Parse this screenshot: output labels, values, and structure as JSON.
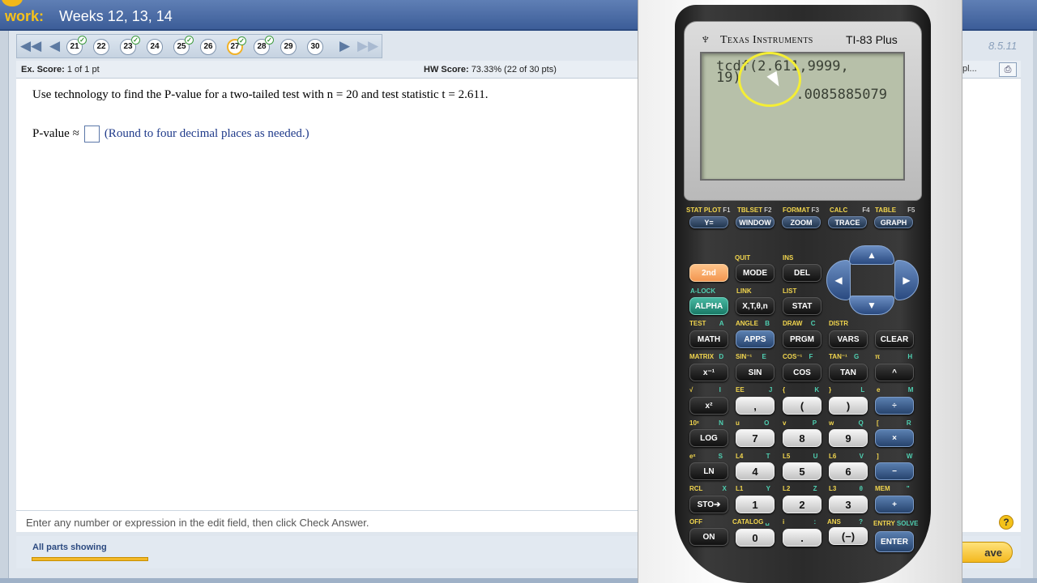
{
  "header": {
    "title_prefix": "work:",
    "title": "Weeks 12, 13, 14"
  },
  "nav": {
    "first": "◀◀",
    "prev": "◀",
    "next": "▶",
    "last": "▶▶",
    "questions": [
      {
        "num": "21",
        "done": "✓"
      },
      {
        "num": "22",
        "done": ""
      },
      {
        "num": "23",
        "done": "✓"
      },
      {
        "num": "24",
        "done": ""
      },
      {
        "num": "25",
        "done": "✓"
      },
      {
        "num": "26",
        "done": ""
      },
      {
        "num": "27",
        "done": "✓"
      },
      {
        "num": "28",
        "done": "✓"
      },
      {
        "num": "29",
        "done": ""
      },
      {
        "num": "30",
        "done": ""
      }
    ],
    "current": "27"
  },
  "version": "8.5.11",
  "score": {
    "ex_label": "Ex. Score:",
    "ex_value": "1 of 1 pt",
    "hw_label": "HW Score:",
    "hw_value": "73.33% (22 of 30 pts)"
  },
  "right_frag": "pl...",
  "question": {
    "text": "Use technology to find the P-value for a two-tailed test with n = 20 and test statistic t = 2.611.",
    "answer_label": "P-value ≈",
    "answer_value": "",
    "hint": "(Round to four decimal places as needed.)"
  },
  "instruction": "Enter any number or expression in the edit field, then click Check Answer.",
  "help_icon": "?",
  "parts": {
    "label": "All parts showing"
  },
  "save_button": "ave",
  "calculator": {
    "brand_logo": "♆",
    "brand": "Texas Instruments",
    "model": "TI-83 Plus",
    "screen": {
      "line1": "tcdf(2.611,9999,",
      "line2": "19)",
      "result": ".0085885079"
    },
    "function_labels": [
      {
        "top": "STAT PLOT",
        "f": "F1",
        "key": "Y="
      },
      {
        "top": "TBLSET",
        "f": "F2",
        "key": "WINDOW"
      },
      {
        "top": "FORMAT",
        "f": "F3",
        "key": "ZOOM"
      },
      {
        "top": "CALC",
        "f": "F4",
        "key": "TRACE"
      },
      {
        "top": "TABLE",
        "f": "F5",
        "key": "GRAPH"
      }
    ],
    "keys": {
      "second": "2nd",
      "mode": "MODE",
      "del": "DEL",
      "quit": "QUIT",
      "ins": "INS",
      "alock": "A-LOCK",
      "link": "LINK",
      "list": "LIST",
      "alpha": "ALPHA",
      "xt": "X,T,θ,n",
      "stat": "STAT",
      "test": "TEST",
      "a": "A",
      "angle": "ANGLE",
      "b": "B",
      "draw": "DRAW",
      "c": "C",
      "distr": "DISTR",
      "math": "MATH",
      "apps": "APPS",
      "prgm": "PRGM",
      "vars": "VARS",
      "clear": "CLEAR",
      "matrix": "MATRIX",
      "d": "D",
      "sin_inv": "SIN⁻¹",
      "e": "E",
      "cos_inv": "COS⁻¹",
      "f": "F",
      "tan_inv": "TAN⁻¹",
      "g": "G",
      "pi": "π",
      "h": "H",
      "xinv": "x⁻¹",
      "sin": "SIN",
      "cos": "COS",
      "tan": "TAN",
      "caret": "^",
      "sqrt": "√",
      "i": "I",
      "ee": "EE",
      "j": "J",
      "lbrace": "{",
      "k": "K",
      "rbrace": "}",
      "l": "L",
      "e_const": "e",
      "m": "M",
      "x2": "x²",
      "comma": ",",
      "lparen": "(",
      "rparen": ")",
      "div": "÷",
      "tenx": "10ˣ",
      "n": "N",
      "u": "u",
      "o": "O",
      "v": "v",
      "p": "P",
      "w": "w",
      "q": "Q",
      "lbr": "[",
      "r": "R",
      "log": "LOG",
      "seven": "7",
      "eight": "8",
      "nine": "9",
      "times": "×",
      "ex": "eˣ",
      "s": "S",
      "l4": "L4",
      "t": "T",
      "l5": "L5",
      "u2": "U",
      "l6": "L6",
      "v2": "V",
      "rbr": "]",
      "w2": "W",
      "ln": "LN",
      "four": "4",
      "five": "5",
      "six": "6",
      "minus": "−",
      "rcl": "RCL",
      "x": "X",
      "l1": "L1",
      "y": "Y",
      "l2": "L2",
      "z": "Z",
      "l3": "L3",
      "theta": "θ",
      "mem": "MEM",
      "quote": "\"",
      "sto": "STO➔",
      "one": "1",
      "two": "2",
      "three": "3",
      "plus": "+",
      "off": "OFF",
      "catalog": "CATALOG",
      "space": "␣",
      "i2": "i",
      "colon": ":",
      "ans": "ANS",
      "question": "?",
      "entry": "ENTRY",
      "solve": "SOLVE",
      "on": "ON",
      "zero": "0",
      "dot": ".",
      "neg": "(−)",
      "enter": "ENTER"
    }
  },
  "colors": {
    "header": "#3c5d98",
    "accent": "#f3b828",
    "lcd": "#b7c0a9",
    "key_orange": "#f39650",
    "key_green": "#197a66"
  }
}
